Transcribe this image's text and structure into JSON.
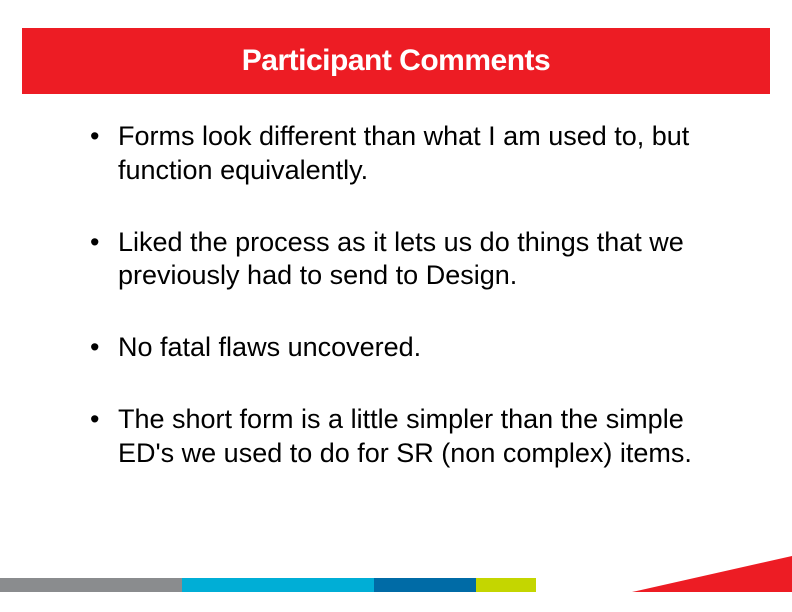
{
  "title": "Participant Comments",
  "bullets": [
    "Forms look different than what I am used to, but function equivalently.",
    "Liked the process as it lets us do things that we previously had to send to Design.",
    "No fatal flaws uncovered.",
    "The short form is a little simpler than the simple ED's we used to do for SR  (non complex) items."
  ],
  "colors": {
    "red": "#ed1c24",
    "gray": "#8a8c8e",
    "blue": "#00aed6",
    "darkblue": "#006ba6",
    "lime": "#c4d600"
  }
}
